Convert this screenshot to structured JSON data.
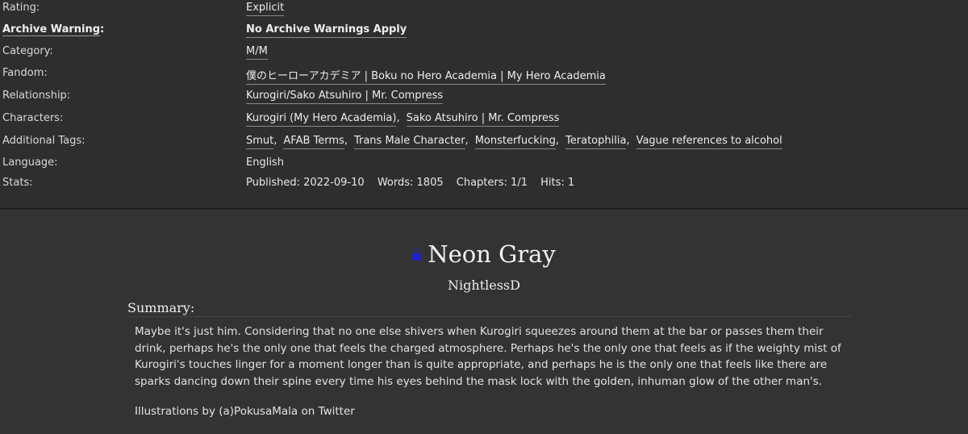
{
  "meta": {
    "rating": {
      "label": "Rating:",
      "value": "Explicit"
    },
    "warning": {
      "label": "Archive Warning",
      "colon": ":",
      "value": "No Archive Warnings Apply"
    },
    "category": {
      "label": "Category:",
      "value": "M/M"
    },
    "fandom": {
      "label": "Fandom:",
      "tags": [
        "僕のヒーローアカデミア | Boku no Hero Academia | My Hero Academia"
      ]
    },
    "relationship": {
      "label": "Relationship:",
      "tags": [
        "Kurogiri/Sako Atsuhiro | Mr. Compress"
      ]
    },
    "characters": {
      "label": "Characters:",
      "tags": [
        "Kurogiri (My Hero Academia)",
        "Sako Atsuhiro | Mr. Compress"
      ]
    },
    "additional_tags": {
      "label": "Additional Tags:",
      "tags": [
        "Smut",
        "AFAB Terms",
        "Trans Male Character",
        "Monsterfucking",
        "Teratophilia",
        "Vague references to alcohol"
      ]
    },
    "language": {
      "label": "Language:",
      "value": "English"
    },
    "stats": {
      "label": "Stats:",
      "published_label": "Published:",
      "published": "2022-09-10",
      "words_label": "Words:",
      "words": "1805",
      "chapters_label": "Chapters:",
      "chapters": "1/1",
      "hits_label": "Hits:",
      "hits": "1"
    }
  },
  "work": {
    "lock_icon": "lock-icon",
    "lock_color": "#2020c8",
    "title": "Neon Gray",
    "author": "NightlessD",
    "summary_heading": "Summary:",
    "summary": [
      "Maybe it's just him. Considering that no one else shivers when Kurogiri squeezes around them at the bar or passes them their drink, perhaps he's the only one that feels the charged atmosphere. Perhaps he's the only one that feels as if the weighty mist of Kurogiri's touches linger for a moment longer than is quite appropriate, and perhaps he is the only one that feels like there are sparks dancing down their spine every time his eyes behind the mask lock with the golden, inhuman glow of the other man's.",
      "Illustrations by (a)PokusaMala on Twitter"
    ]
  }
}
